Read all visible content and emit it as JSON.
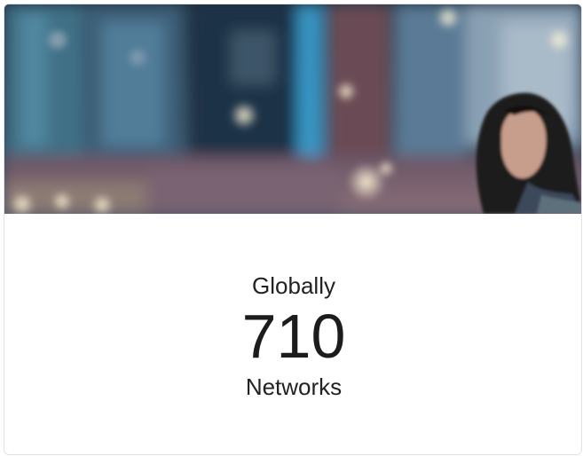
{
  "card": {
    "image_description_icon": "city-night-woman-image",
    "stat": {
      "label": "Globally",
      "value": "710",
      "unit": "Networks"
    }
  },
  "colors": {
    "text": "#222222",
    "border": "#e2e2e2",
    "background": "#ffffff"
  }
}
